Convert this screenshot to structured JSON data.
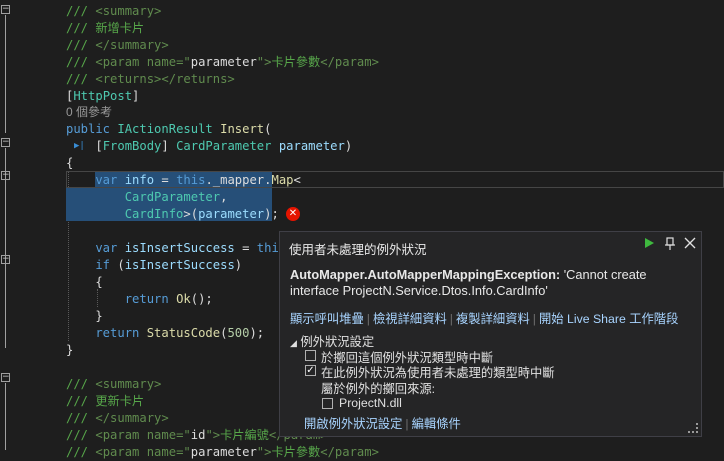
{
  "editor": {
    "lines": [
      {
        "seg": [
          {
            "t": "/// ",
            "c": "c-cm"
          },
          {
            "t": "<summary>",
            "c": "c-doc"
          }
        ]
      },
      {
        "seg": [
          {
            "t": "/// 新增卡片",
            "c": "c-cm"
          }
        ]
      },
      {
        "seg": [
          {
            "t": "/// ",
            "c": "c-cm"
          },
          {
            "t": "</summary>",
            "c": "c-doc"
          }
        ]
      },
      {
        "seg": [
          {
            "t": "/// ",
            "c": "c-cm"
          },
          {
            "t": "<param name=\"",
            "c": "c-doc"
          },
          {
            "t": "parameter",
            "c": "c-plain"
          },
          {
            "t": "\">",
            "c": "c-doc"
          },
          {
            "t": "卡片參數",
            "c": "c-cm"
          },
          {
            "t": "</param>",
            "c": "c-doc"
          }
        ]
      },
      {
        "seg": [
          {
            "t": "/// ",
            "c": "c-cm"
          },
          {
            "t": "<returns></returns>",
            "c": "c-doc"
          }
        ]
      },
      {
        "seg": [
          {
            "t": "[",
            "c": "c-plain"
          },
          {
            "t": "HttpPost",
            "c": "c-attr"
          },
          {
            "t": "]",
            "c": "c-plain"
          }
        ]
      },
      {
        "seg": [
          {
            "t": "public ",
            "c": "c-kw"
          },
          {
            "t": "IActionResult ",
            "c": "c-type"
          },
          {
            "t": "Insert",
            "c": "c-method"
          },
          {
            "t": "(",
            "c": "c-plain"
          }
        ]
      },
      {
        "seg": [
          {
            "t": "    [",
            "c": "c-plain"
          },
          {
            "t": "FromBody",
            "c": "c-attr"
          },
          {
            "t": "] ",
            "c": "c-plain"
          },
          {
            "t": "CardParameter ",
            "c": "c-type"
          },
          {
            "t": "parameter",
            "c": "c-param"
          },
          {
            "t": ")",
            "c": "c-plain"
          }
        ]
      },
      {
        "seg": [
          {
            "t": "{",
            "c": "c-plain"
          }
        ]
      },
      {
        "seg": [
          {
            "t": "    var ",
            "c": "c-kw"
          },
          {
            "t": "info",
            "c": "c-param"
          },
          {
            "t": " = ",
            "c": "c-plain"
          },
          {
            "t": "this",
            "c": "c-kw"
          },
          {
            "t": "._mapper.",
            "c": "c-plain"
          },
          {
            "t": "Map",
            "c": "c-method"
          },
          {
            "t": "<",
            "c": "c-plain"
          }
        ]
      },
      {
        "seg": [
          {
            "t": "        CardParameter",
            "c": "c-type"
          },
          {
            "t": ",",
            "c": "c-plain"
          }
        ]
      },
      {
        "seg": [
          {
            "t": "        CardInfo",
            "c": "c-type"
          },
          {
            "t": ">(",
            "c": "c-plain"
          },
          {
            "t": "parameter",
            "c": "c-param"
          },
          {
            "t": ");",
            "c": "c-plain"
          }
        ]
      },
      {
        "seg": []
      },
      {
        "seg": [
          {
            "t": "    var ",
            "c": "c-kw"
          },
          {
            "t": "isInsertSuccess",
            "c": "c-param"
          },
          {
            "t": " = ",
            "c": "c-plain"
          },
          {
            "t": "this",
            "c": "c-kw"
          }
        ]
      },
      {
        "seg": [
          {
            "t": "    if ",
            "c": "c-kw"
          },
          {
            "t": "(",
            "c": "c-plain"
          },
          {
            "t": "isInsertSuccess",
            "c": "c-param"
          },
          {
            "t": ")",
            "c": "c-plain"
          }
        ]
      },
      {
        "seg": [
          {
            "t": "    {",
            "c": "c-plain"
          }
        ]
      },
      {
        "seg": [
          {
            "t": "        return ",
            "c": "c-kw"
          },
          {
            "t": "Ok",
            "c": "c-method"
          },
          {
            "t": "();",
            "c": "c-plain"
          }
        ]
      },
      {
        "seg": [
          {
            "t": "    }",
            "c": "c-plain"
          }
        ]
      },
      {
        "seg": [
          {
            "t": "    return ",
            "c": "c-kw"
          },
          {
            "t": "StatusCode",
            "c": "c-method"
          },
          {
            "t": "(",
            "c": "c-plain"
          },
          {
            "t": "500",
            "c": "c-num"
          },
          {
            "t": ");",
            "c": "c-plain"
          }
        ]
      },
      {
        "seg": [
          {
            "t": "}",
            "c": "c-plain"
          }
        ]
      },
      {
        "seg": []
      },
      {
        "seg": [
          {
            "t": "/// ",
            "c": "c-cm"
          },
          {
            "t": "<summary>",
            "c": "c-doc"
          }
        ]
      },
      {
        "seg": [
          {
            "t": "/// 更新卡片",
            "c": "c-cm"
          }
        ]
      },
      {
        "seg": [
          {
            "t": "/// ",
            "c": "c-cm"
          },
          {
            "t": "</summary>",
            "c": "c-doc"
          }
        ]
      },
      {
        "seg": [
          {
            "t": "/// ",
            "c": "c-cm"
          },
          {
            "t": "<param name=\"",
            "c": "c-doc"
          },
          {
            "t": "id",
            "c": "c-plain"
          },
          {
            "t": "\">",
            "c": "c-doc"
          },
          {
            "t": "卡片編號",
            "c": "c-cm"
          },
          {
            "t": "</param>",
            "c": "c-doc"
          }
        ]
      },
      {
        "seg": [
          {
            "t": "/// ",
            "c": "c-cm"
          },
          {
            "t": "<param name=\"",
            "c": "c-doc"
          },
          {
            "t": "parameter",
            "c": "c-plain"
          },
          {
            "t": "\">",
            "c": "c-doc"
          },
          {
            "t": "卡片參數",
            "c": "c-cm"
          },
          {
            "t": "</param>",
            "c": "c-doc"
          }
        ]
      }
    ],
    "codelens": "0 個參考"
  },
  "popup": {
    "title": "使用者未處理的例外狀況",
    "exception_type": "AutoMapper.AutoMapperMappingException:",
    "exception_message": " 'Cannot create interface ProjectN.Service.Dtos.Info.CardInfo'",
    "links": [
      "顯示呼叫堆疊",
      "檢視詳細資料",
      "複製詳細資料",
      "開始 Live Share 工作階段"
    ],
    "settings_header": "例外狀況設定",
    "options": [
      {
        "label": "於擲回這個例外狀況類型時中斷",
        "checked": false
      },
      {
        "label": "在此例外狀況為使用者未處理的類型時中斷",
        "checked": true
      }
    ],
    "except_from_label": "屬於例外的擲回來源:",
    "source_option": {
      "label": "ProjectN.dll",
      "checked": false
    },
    "bottom_links": [
      "開啟例外狀況設定",
      "編輯條件"
    ],
    "icons": {
      "continue": "play-icon",
      "pin": "pin-icon",
      "close": "close-icon",
      "error": "error-icon"
    },
    "colors": {
      "link": "#a8d4ff",
      "continue": "#3fb93f",
      "error": "#e51400"
    }
  }
}
